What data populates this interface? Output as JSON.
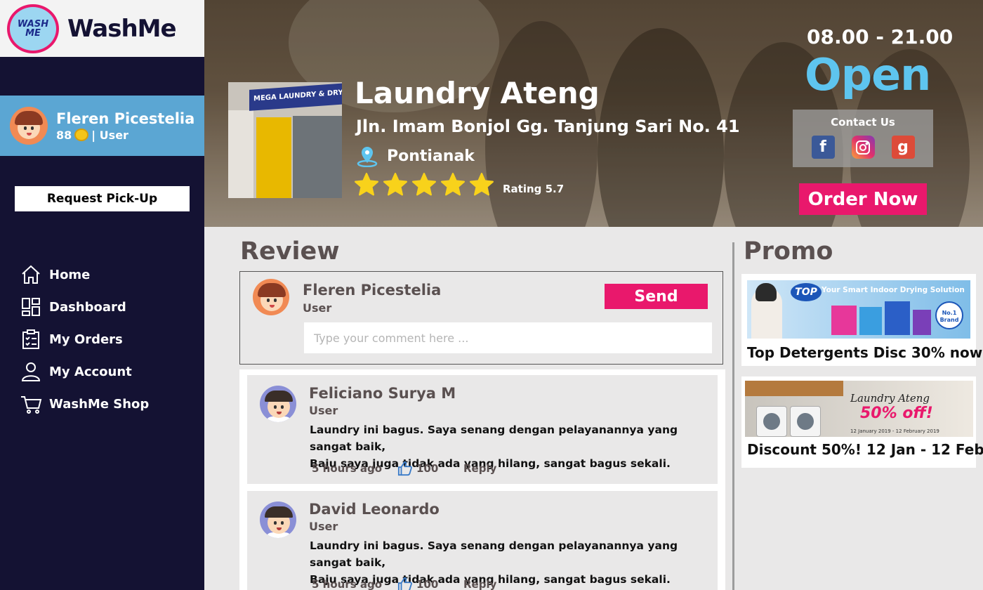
{
  "brand": {
    "logo_text": "WASH ME",
    "name": "WashMe"
  },
  "user": {
    "name": "Fleren Picestelia",
    "coins": "88",
    "role_label": "| User"
  },
  "sidebar": {
    "pickup_label": "Request Pick-Up",
    "nav": [
      {
        "label": "Home",
        "icon": "home-icon"
      },
      {
        "label": "Dashboard",
        "icon": "dashboard-icon"
      },
      {
        "label": "My Orders",
        "icon": "clipboard-icon"
      },
      {
        "label": "My Account",
        "icon": "user-icon"
      },
      {
        "label": "WashMe Shop",
        "icon": "cart-icon"
      }
    ]
  },
  "shop": {
    "photo_sign": "MEGA LAUNDRY & DRY CLEA",
    "name": "Laundry Ateng",
    "address": "Jln. Imam Bonjol Gg. Tanjung Sari No. 41",
    "city": "Pontianak",
    "stars": 5,
    "rating_label": "Rating 5.7",
    "hours": "08.00 - 21.00",
    "status": "Open",
    "contact_title": "Contact Us",
    "order_label": "Order Now"
  },
  "colors": {
    "accent": "#e9186c",
    "sidebar": "#141233",
    "user_card": "#5ba6d3",
    "open": "#5ec5ef",
    "star": "#f8d21b"
  },
  "review": {
    "title": "Review",
    "compose": {
      "name": "Fleren Picestelia",
      "role": "User",
      "send_label": "Send",
      "placeholder": "Type your comment here ..."
    },
    "items": [
      {
        "name": "Feliciano Surya M",
        "role": "User",
        "text_line1": "Laundry ini bagus. Saya senang dengan pelayanannya yang sangat baik,",
        "text_line2": "Baju saya juga tidak ada yang hilang, sangat bagus sekali.",
        "time": "5 hours ago",
        "likes": "100",
        "reply_label": "Reply"
      },
      {
        "name": "David Leonardo",
        "role": "User",
        "text_line1": "Laundry ini bagus. Saya senang dengan pelayanannya yang sangat baik,",
        "text_line2": "Baju saya juga tidak ada yang hilang, sangat bagus sekali.",
        "time": "5 hours ago",
        "likes": "100",
        "reply_label": "Reply"
      }
    ]
  },
  "promo": {
    "title": "Promo",
    "items": [
      {
        "caption": "Top Detergents Disc 30% now!",
        "banner_text": "Your Smart Indoor Drying Solution",
        "brand_text": "TOP",
        "badge_text": "No.1 Brand"
      },
      {
        "caption": "Discount 50%! 12 Jan - 12 Feb!",
        "banner_title": "Laundry Ateng",
        "banner_offer": "50% off!",
        "banner_dates": "12 January 2019 - 12 February 2019"
      }
    ]
  }
}
